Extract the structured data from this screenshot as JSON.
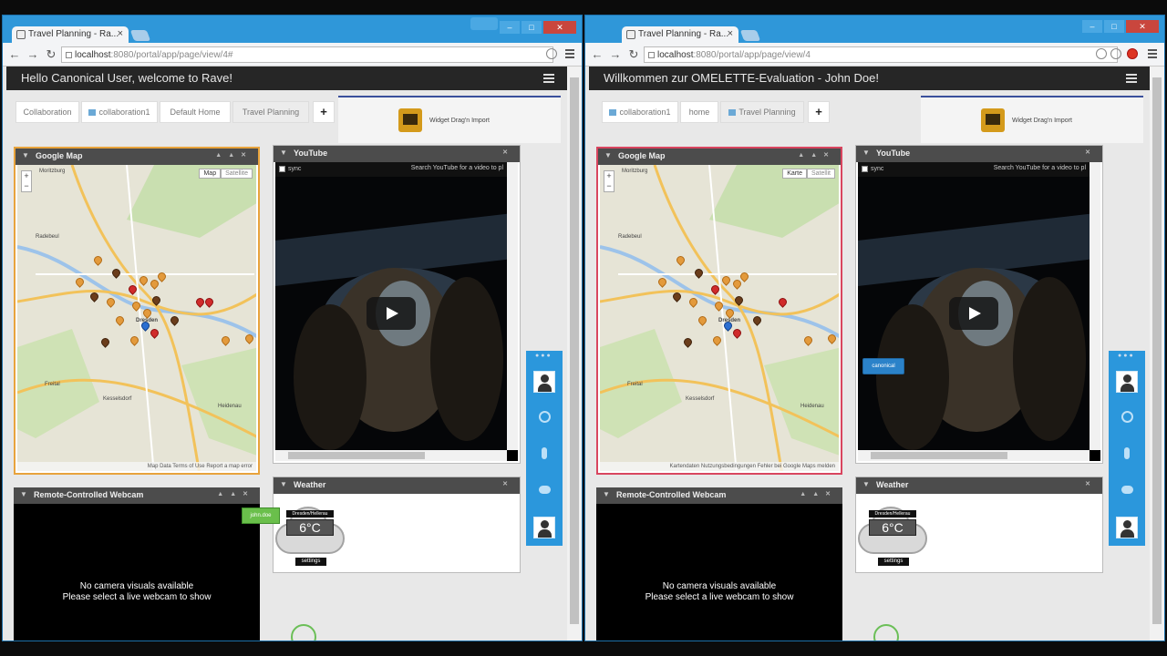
{
  "windows": [
    {
      "tab": {
        "title": "Travel Planning - Ra...",
        "close": "×"
      },
      "url": {
        "host": "localhost",
        "path": ":8080/portal/app/page/view/4#"
      },
      "welcome": "Hello Canonical User, welcome to Rave!",
      "page_tabs": [
        "Collaboration",
        "collaboration1",
        "Default Home",
        "Travel Planning"
      ],
      "add_tab": "+",
      "widget_drag_label": "Widget Drag'n Import",
      "map": {
        "title": "Google Map",
        "btn_map": "Map",
        "btn_sat": "Satellite",
        "zoom_in": "+",
        "zoom_out": "−",
        "footer": "Map Data   Terms of Use   Report a map error"
      },
      "youtube": {
        "title": "YouTube",
        "sync": "sync",
        "placeholder": "Search YouTube for a video to pl"
      },
      "webcam": {
        "title": "Remote-Controlled Webcam",
        "line1": "No camera visuals available",
        "line2": "Please select a live webcam to show"
      },
      "weather": {
        "title": "Weather",
        "city": "Dresden/Hellerau",
        "temp": "6°C",
        "settings": "settings"
      },
      "tooltip": "john.doe"
    },
    {
      "tab": {
        "title": "Travel Planning - Ra...",
        "close": "×"
      },
      "url": {
        "host": "localhost",
        "path": ":8080/portal/app/page/view/4"
      },
      "welcome": "Willkommen zur OMELETTE-Evaluation - John Doe!",
      "page_tabs": [
        "collaboration1",
        "home",
        "Travel Planning"
      ],
      "add_tab": "+",
      "widget_drag_label": "Widget Drag'n Import",
      "map": {
        "title": "Google Map",
        "btn_map": "Karte",
        "btn_sat": "Satellit",
        "zoom_in": "+",
        "zoom_out": "−",
        "footer": "Kartendaten   Nutzungsbedingungen   Fehler bei Google Maps melden"
      },
      "youtube": {
        "title": "YouTube",
        "sync": "sync",
        "placeholder": "Search YouTube for a video to pl"
      },
      "webcam": {
        "title": "Remote-Controlled Webcam",
        "line1": "No camera visuals available",
        "line2": "Please select a live webcam to show"
      },
      "weather": {
        "title": "Weather",
        "city": "Dresden/Hellerau",
        "temp": "6°C",
        "settings": "settings"
      },
      "tooltip": "canonical"
    }
  ],
  "map_labels": {
    "moritzburg": "Moritzburg",
    "radebeul": "Radebeul",
    "dresden": "Dresden",
    "freital": "Freital",
    "kesselsdorf": "Kesselsdorf",
    "heidenau": "Heidenau"
  },
  "colors": {
    "window_frame": "#2f97d9",
    "active_map_border_left": "#e8a33c",
    "active_map_border_right": "#d9455f",
    "sidebar": "#2b97dc"
  },
  "icons": [
    "favicon-icon",
    "back-icon",
    "forward-icon",
    "reload-icon",
    "menu-icon",
    "collapse-chevron-icon",
    "play-icon",
    "avatar-icon",
    "add-user-icon",
    "microphone-icon",
    "chat-icon",
    "map-pin-icon",
    "cloud-icon"
  ]
}
